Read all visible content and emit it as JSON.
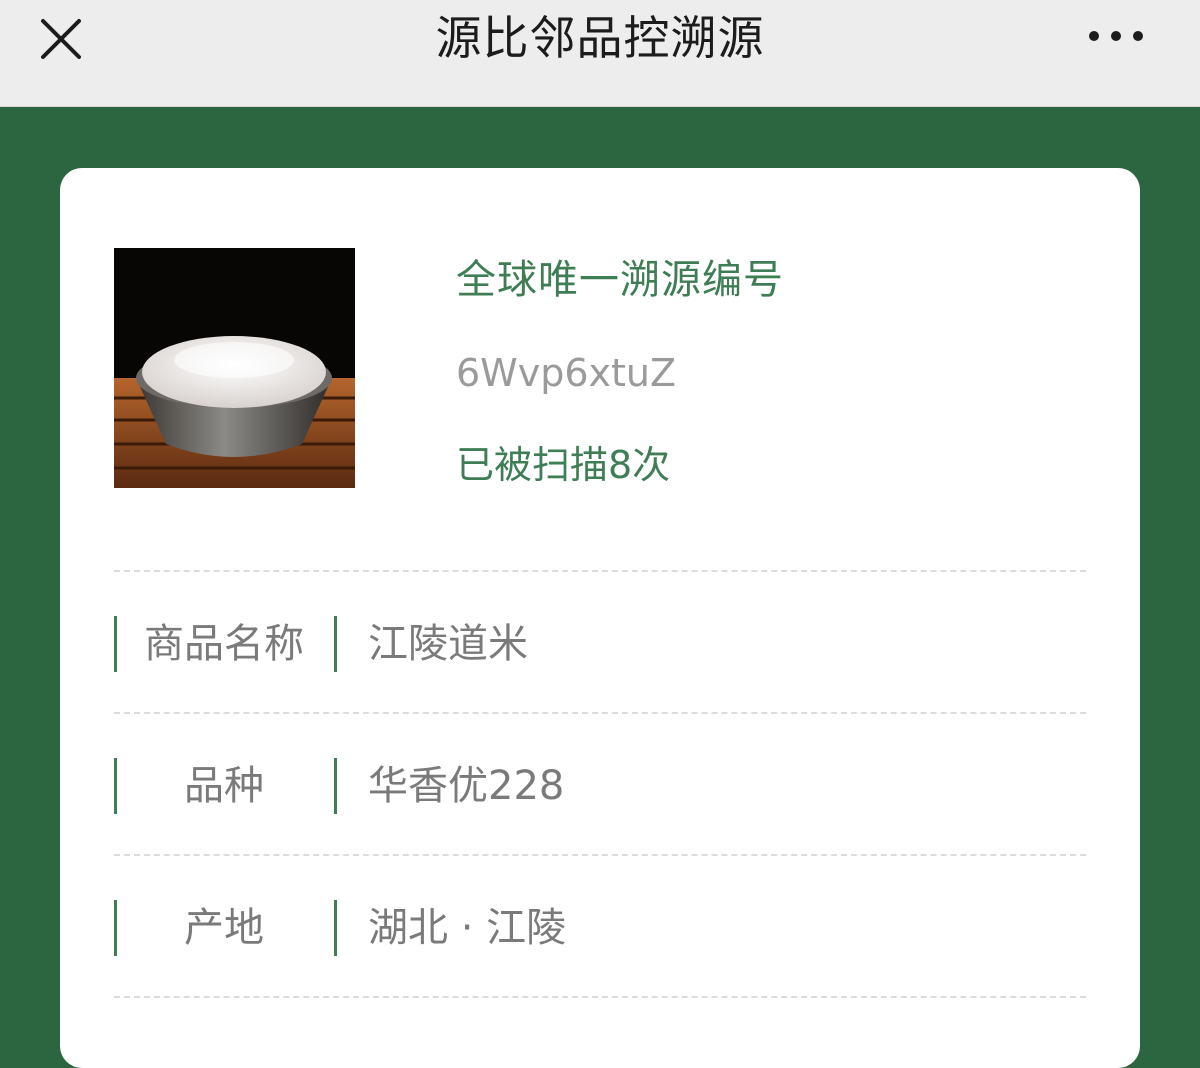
{
  "header": {
    "title": "源比邻品控溯源",
    "close_icon": "close-icon",
    "more_icon": "more-horizontal-icon"
  },
  "product": {
    "image": "rice-bowl-image",
    "trace_heading": "全球唯一溯源编号",
    "trace_code": "6Wvp6xtuZ",
    "scan_count": "已被扫描8次"
  },
  "details": [
    {
      "label": "商品名称",
      "value": "江陵道米"
    },
    {
      "label": "品种",
      "value": "华香优228"
    },
    {
      "label": "产地",
      "value": "湖北 · 江陵"
    }
  ],
  "colors": {
    "brand_green": "#2b6640",
    "accent_green": "#3f7d55",
    "text_gray": "#7a7a7a"
  }
}
